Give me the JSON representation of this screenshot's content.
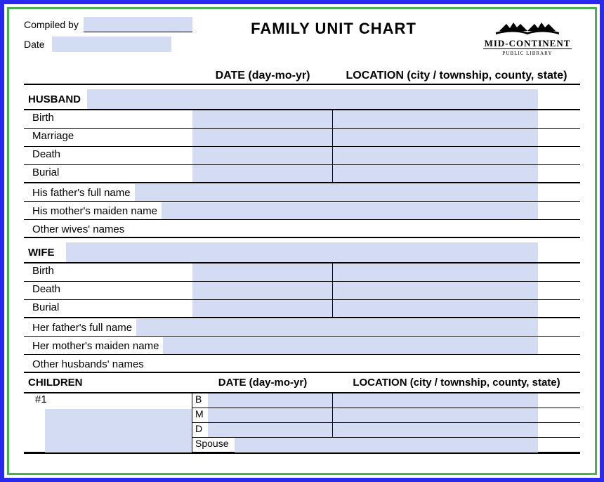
{
  "header": {
    "compiled_label": "Compiled by",
    "compiled_value": "",
    "date_label": "Date",
    "date_value": "",
    "title": "FAMILY UNIT CHART",
    "logo_main": "MID-CONTINENT",
    "logo_sub": "PUBLIC LIBRARY"
  },
  "columns": {
    "date_header": "DATE (day-mo-yr)",
    "location_header": "LOCATION (city / township, county, state)"
  },
  "husband": {
    "section_label": "HUSBAND",
    "name_value": "",
    "rows": {
      "birth": {
        "label": "Birth",
        "date": "",
        "location": ""
      },
      "marriage": {
        "label": "Marriage",
        "date": "",
        "location": ""
      },
      "death": {
        "label": "Death",
        "date": "",
        "location": ""
      },
      "burial": {
        "label": "Burial",
        "date": "",
        "location": ""
      }
    },
    "father_label": "His father's full name",
    "father_value": "",
    "mother_label": "His mother's maiden name",
    "mother_value": "",
    "other_wives_label": "Other wives' names",
    "other_wives_value": ""
  },
  "wife": {
    "section_label": "WIFE",
    "name_value": "",
    "rows": {
      "birth": {
        "label": "Birth",
        "date": "",
        "location": ""
      },
      "death": {
        "label": "Death",
        "date": "",
        "location": ""
      },
      "burial": {
        "label": "Burial",
        "date": "",
        "location": ""
      }
    },
    "father_label": "Her father's full name",
    "father_value": "",
    "mother_label": "Her mother's maiden name",
    "mother_value": "",
    "other_husbands_label": "Other husbands' names",
    "other_husbands_value": ""
  },
  "children": {
    "section_label": "CHILDREN",
    "date_header": "DATE (day-mo-yr)",
    "location_header": "LOCATION (city / township, county, state)",
    "child1": {
      "number": "#1",
      "name": "",
      "b_label": "B",
      "b_date": "",
      "b_loc": "",
      "m_label": "M",
      "m_date": "",
      "m_loc": "",
      "d_label": "D",
      "d_date": "",
      "d_loc": "",
      "spouse_label": "Spouse",
      "spouse_value": ""
    }
  }
}
